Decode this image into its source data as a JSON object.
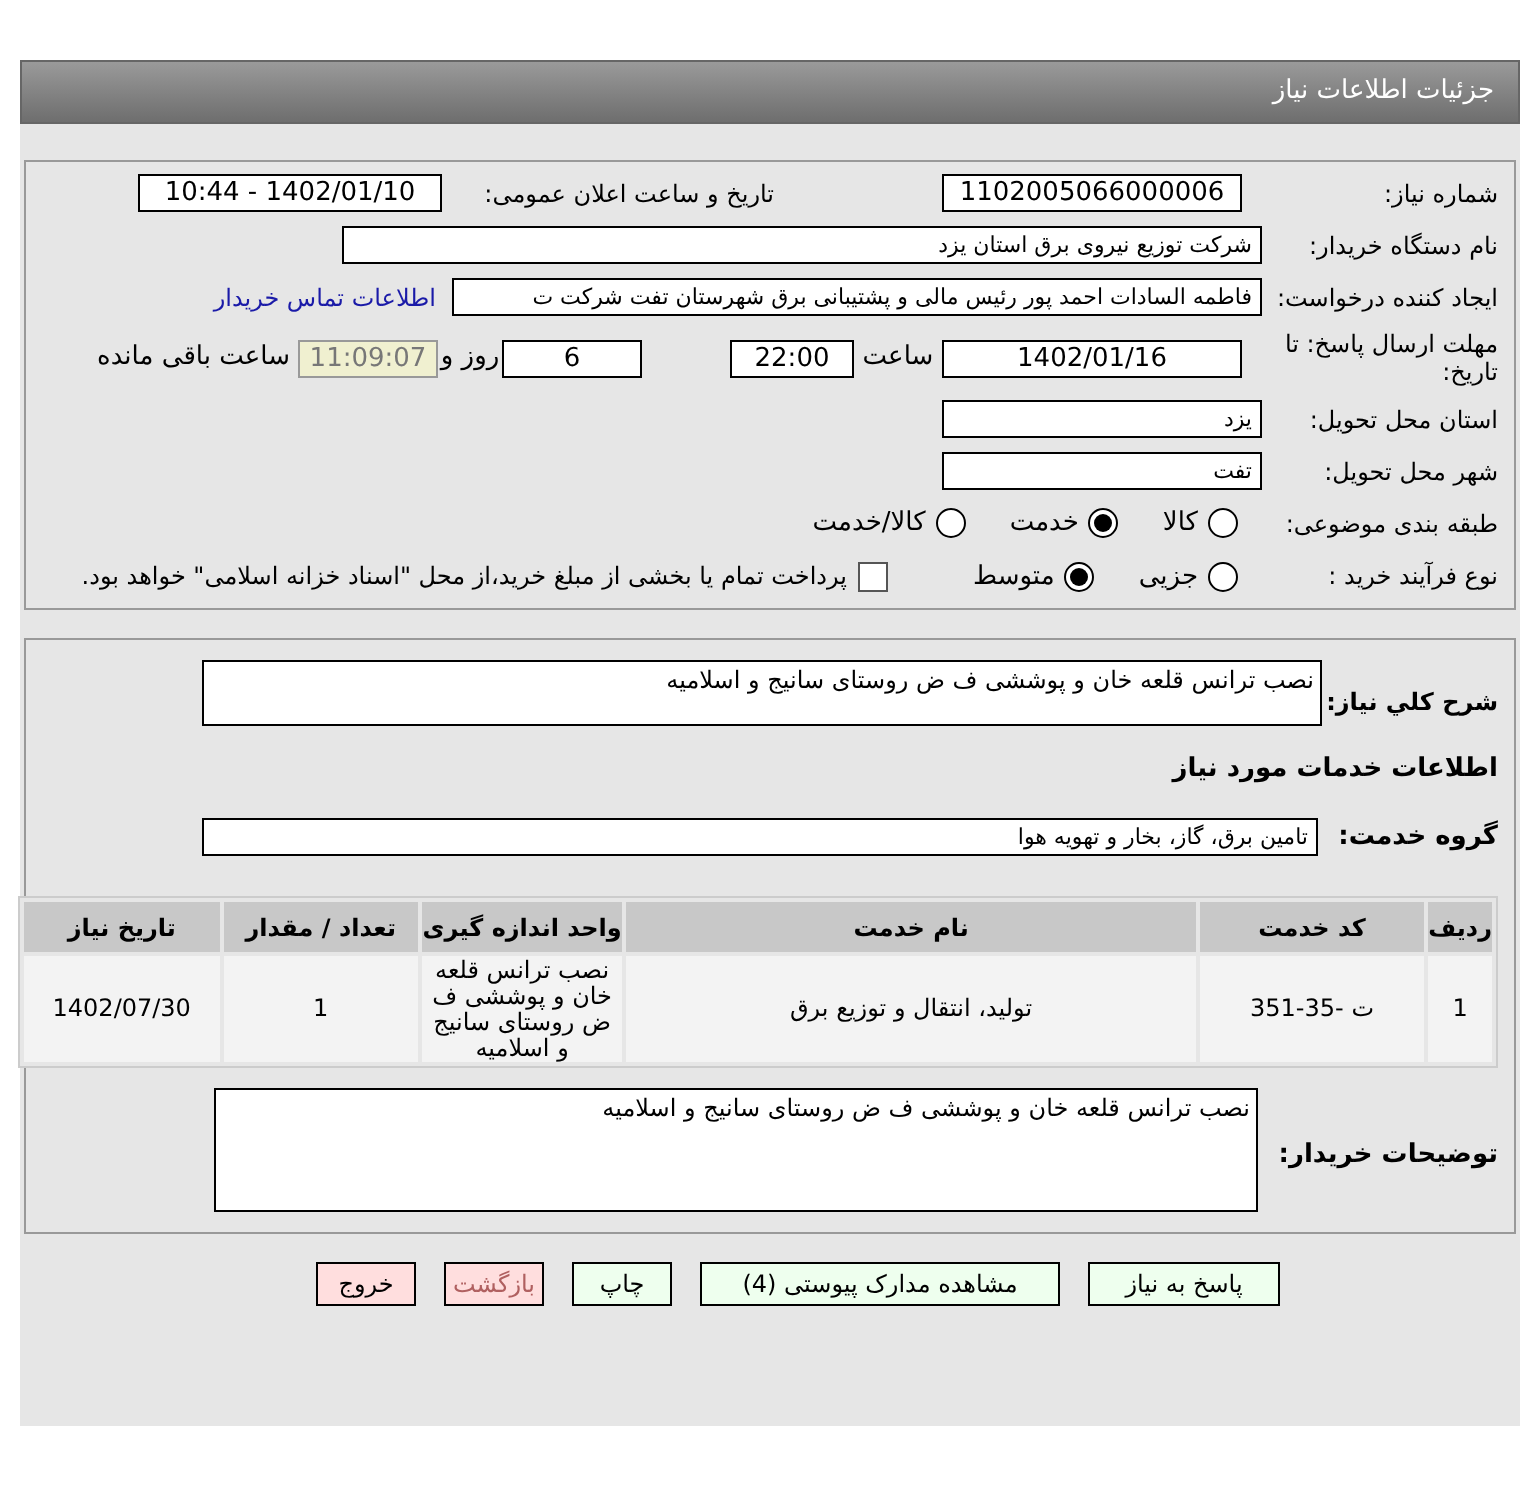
{
  "header": {
    "title": "جزئیات اطلاعات نیاز"
  },
  "details": {
    "need_number": {
      "label": "شماره نیاز:",
      "value": "1102005066000006"
    },
    "announce": {
      "label": "تاریخ و ساعت اعلان عمومی:",
      "value": "1402/01/10 - 10:44"
    },
    "buyer": {
      "label": "نام دستگاه خریدار:",
      "value": "شرکت توزیع نیروی برق استان یزد"
    },
    "creator": {
      "label": "ایجاد کننده درخواست:",
      "value": "فاطمه السادات  احمد پور  رئیس مالی و پشتیبانی برق شهرستان تفت شرکت ت",
      "link": "اطلاعات تماس خریدار"
    },
    "deadline": {
      "label": "مهلت ارسال پاسخ: تا تاریخ:",
      "date": "1402/01/16",
      "time_label": "ساعت",
      "time": "22:00",
      "days": "6",
      "days_label": "روز و",
      "remaining": "11:09:07",
      "remaining_label": "ساعت باقی مانده"
    },
    "province": {
      "label": "استان محل تحویل:",
      "value": "یزد"
    },
    "city": {
      "label": "شهر محل تحویل:",
      "value": "تفت"
    },
    "category": {
      "label": "طبقه بندی موضوعی:",
      "options": [
        {
          "label": "کالا",
          "selected": false
        },
        {
          "label": "خدمت",
          "selected": true
        },
        {
          "label": "کالا/خدمت",
          "selected": false
        }
      ]
    },
    "process": {
      "label": "نوع فرآیند خرید :",
      "options": [
        {
          "label": "جزیی",
          "selected": false
        },
        {
          "label": "متوسط",
          "selected": true
        }
      ],
      "payment": {
        "label": "پرداخت تمام یا بخشی از مبلغ خرید،از محل \"اسناد خزانه اسلامی\" خواهد بود.",
        "checked": false
      }
    }
  },
  "services": {
    "summary": {
      "label": "شرح کلي نياز:",
      "value": "نصب ترانس قلعه خان و پوششی ف ض روستای سانیج و اسلامیه"
    },
    "section_title": "اطلاعات خدمات مورد نیاز",
    "group": {
      "label": "گروه خدمت:",
      "value": "تامین برق، گاز، بخار و تهویه هوا"
    },
    "table": {
      "columns": [
        "ردیف",
        "کد خدمت",
        "نام خدمت",
        "واحد اندازه گیری",
        "تعداد / مقدار",
        "تاریخ نیاز"
      ],
      "rows": [
        [
          "1",
          "ت -35-351",
          "تولید، انتقال و توزیع برق",
          "نصب ترانس قلعه خان و پوششی ف ض روستای سانیج و اسلامیه",
          "1",
          "1402/07/30"
        ]
      ]
    },
    "buyer_notes": {
      "label": "توضیحات خریدار:",
      "value": "نصب ترانس قلعه خان و پوششی ف ض روستای سانیج و اسلامیه"
    }
  },
  "buttons": [
    {
      "label": "پاسخ به نیاز",
      "kind": "action"
    },
    {
      "label": "مشاهده مدارک پیوستی (4)",
      "kind": "action"
    },
    {
      "label": "چاپ",
      "kind": "action"
    },
    {
      "label": "بازگشت",
      "kind": "exit"
    },
    {
      "label": "خروج",
      "kind": "exit"
    }
  ]
}
